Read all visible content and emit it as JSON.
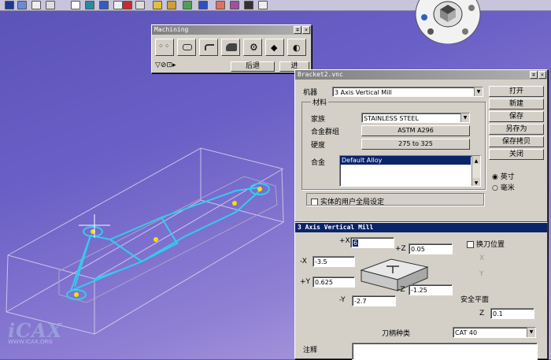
{
  "machining_toolbar": {
    "title": "Machining",
    "btn_left": "后退",
    "btn_right": "进"
  },
  "bracket_window": {
    "title": "Bracket2.vnc",
    "machine_label": "机器",
    "machine_value": "3 Axis Vertical Mill",
    "material_group": "材料",
    "family_label": "家族",
    "family_value": "STAINLESS STEEL",
    "alloy_group_label": "合金群组",
    "alloy_group_value": "ASTM A296",
    "hardness_label": "硬度",
    "hardness_value": "275 to 325",
    "alloy_label": "合金",
    "alloy_value": "Default Alloy",
    "user_global_checkbox": "实体的用户全局设定",
    "buttons": [
      "打开",
      "新建",
      "保存",
      "另存为",
      "保存拷贝",
      "关闭"
    ],
    "units": [
      "英寸",
      "毫米"
    ]
  },
  "mill_panel": {
    "title": "3 Axis Vertical Mill",
    "plus_x_label": "+X",
    "plus_x_value": "6",
    "plus_z_label": "+Z",
    "plus_z_value": "0.05",
    "minus_x_label": "-X",
    "minus_x_value": "-3.5",
    "plus_y_label": "+Y",
    "plus_y_value": "0.625",
    "minus_z_label": "-Z",
    "minus_z_value": "-1.25",
    "minus_y_label": "-Y",
    "minus_y_value": "-2.7",
    "tool_change_label": "换刀位置",
    "x_label": "X",
    "y_label": "Y",
    "safe_plane_label": "安全平面",
    "z_label": "Z",
    "z_value": "0.1",
    "holder_label": "刀柄种类",
    "holder_value": "CAT 40",
    "notes_label": "注释"
  },
  "watermark": {
    "logo": "iCAX",
    "url": "WWW.ICAX.ORG"
  },
  "colors": {
    "background": "#6a5fc6",
    "toolpath": "#33ccee",
    "wireframe": "#d8d4ee",
    "point": "#ffdd00",
    "titlebar_active": "#0a246a",
    "highlight": "#0a246a"
  }
}
